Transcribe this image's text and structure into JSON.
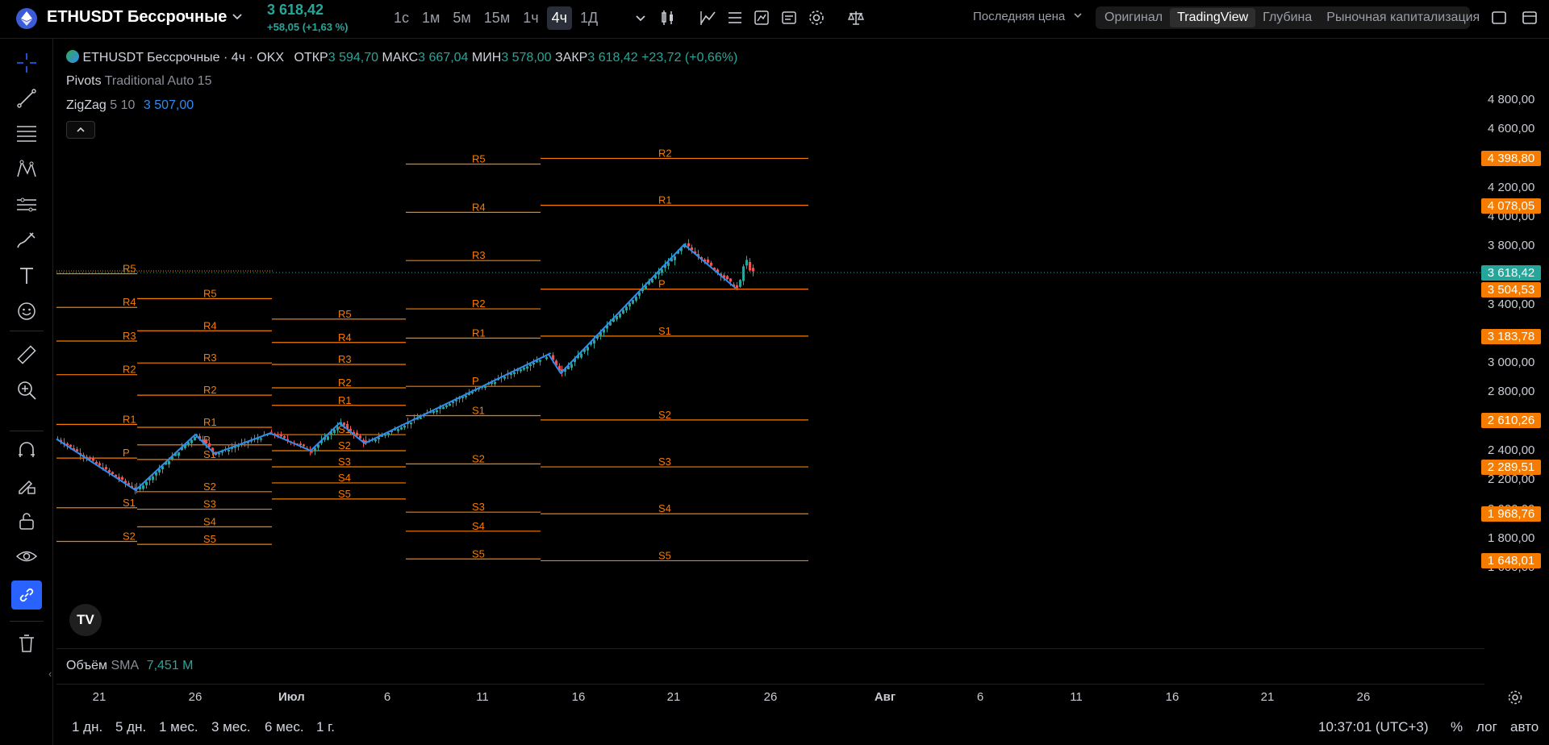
{
  "topbar": {
    "symbol": "ETHUSDT Бессрочные",
    "last_price": "3 618,42",
    "change": "+58,05 (+1,63 %)",
    "intervals": [
      {
        "label": "1с",
        "active": false
      },
      {
        "label": "1м",
        "active": false
      },
      {
        "label": "5м",
        "active": false
      },
      {
        "label": "15м",
        "active": false
      },
      {
        "label": "1ч",
        "active": false
      },
      {
        "label": "4ч",
        "active": true
      },
      {
        "label": "1Д",
        "active": false
      }
    ],
    "price_source": "Последняя цена",
    "chart_types": [
      {
        "label": "Оригинал",
        "active": false
      },
      {
        "label": "TradingView",
        "active": true
      },
      {
        "label": "Глубина",
        "active": false
      },
      {
        "label": "Рыночная капитализация",
        "active": false
      }
    ]
  },
  "legend": {
    "title": "ETHUSDT Бессрочные · 4ч · OKX",
    "open_label": "ОТКР",
    "open": "3 594,70",
    "high_label": "МАКС",
    "high": "3 667,04",
    "low_label": "МИН",
    "low": "3 578,00",
    "close_label": "ЗАКР",
    "close": "3 618,42",
    "change": "+23,72 (+0,66%)",
    "pivots_name": "Pivots",
    "pivots_params": "Traditional Auto 15",
    "zigzag_name": "ZigZag",
    "zigzag_params": "5 10",
    "zigzag_value": "3 507,00"
  },
  "volume": {
    "name": "Объём",
    "ma": "SMA",
    "value": "7,451 M"
  },
  "price_axis": {
    "ticks": [
      "4 800,00",
      "4 600,00",
      "4 200,00",
      "4 000,00",
      "3 800,00",
      "3 400,00",
      "3 000,00",
      "2 800,00",
      "2 400,00",
      "2 200,00",
      "2 000,00",
      "1 800,00",
      "1 600,00"
    ],
    "badges": [
      {
        "value": "4 398,80",
        "color": "#f57c00"
      },
      {
        "value": "4 078,05",
        "color": "#f57c00"
      },
      {
        "value": "3 618,42",
        "color": "#26a69a"
      },
      {
        "value": "3 504,53",
        "color": "#f57c00"
      },
      {
        "value": "3 183,78",
        "color": "#f57c00"
      },
      {
        "value": "2 610,26",
        "color": "#f57c00"
      },
      {
        "value": "2 289,51",
        "color": "#f57c00"
      },
      {
        "value": "1 968,76",
        "color": "#f57c00"
      },
      {
        "value": "1 648,01",
        "color": "#f57c00"
      }
    ]
  },
  "time_axis": {
    "ticks": [
      "21",
      "26",
      "Июл",
      "6",
      "11",
      "16",
      "21",
      "26",
      "Авг",
      "6",
      "11",
      "16",
      "21",
      "26"
    ]
  },
  "bottom": {
    "ranges": [
      "1 дн.",
      "5 дн.",
      "1 мес.",
      "3 мес.",
      "6 мес.",
      "1 г."
    ],
    "clock": "10:37:01 (UTC+3)",
    "percent": "%",
    "log": "лог",
    "auto": "авто"
  },
  "chart_data": {
    "type": "candlestick",
    "y_axis_range": [
      1550,
      4850
    ],
    "pivot_levels": [
      {
        "period": 1,
        "levels": {
          "R5": 3610,
          "R4": 3380,
          "R3": 3150,
          "R2": 2920,
          "R1": 2580,
          "P": 2350,
          "S1": 2010,
          "S2": 1780
        }
      },
      {
        "period": 2,
        "levels": {
          "R5": 3440,
          "R4": 3220,
          "R3": 3000,
          "R2": 2780,
          "R1": 2560,
          "P": 2440,
          "S1": 2340,
          "S2": 2120,
          "S3": 2000,
          "S4": 1880,
          "S5": 1760
        }
      },
      {
        "period": 3,
        "levels": {
          "R5": 3300,
          "R4": 3140,
          "R3": 2990,
          "R2": 2830,
          "R1": 2710,
          "S1": 2510,
          "S2": 2400,
          "S3": 2290,
          "S4": 2180,
          "S5": 2070
        }
      },
      {
        "period": 4,
        "levels": {
          "R5": 4360,
          "R4": 4030,
          "R3": 3700,
          "R2": 3370,
          "R1": 3170,
          "P": 2840,
          "S1": 2640,
          "S2": 2310,
          "S3": 1980,
          "S4": 1850,
          "S5": 1660
        }
      },
      {
        "period": 5,
        "levels": {
          "R2": 4398.8,
          "R1": 4078.05,
          "P": 3504.53,
          "S1": 3183.78,
          "S2": 2610.26,
          "S3": 2289.51,
          "S4": 1968.76,
          "S5": 1648.01
        }
      }
    ],
    "zigzag": [
      2480,
      2130,
      2510,
      2380,
      2520,
      2400,
      2590,
      2450,
      3060,
      2930,
      3810,
      3510
    ],
    "last_price": 3618.42
  }
}
